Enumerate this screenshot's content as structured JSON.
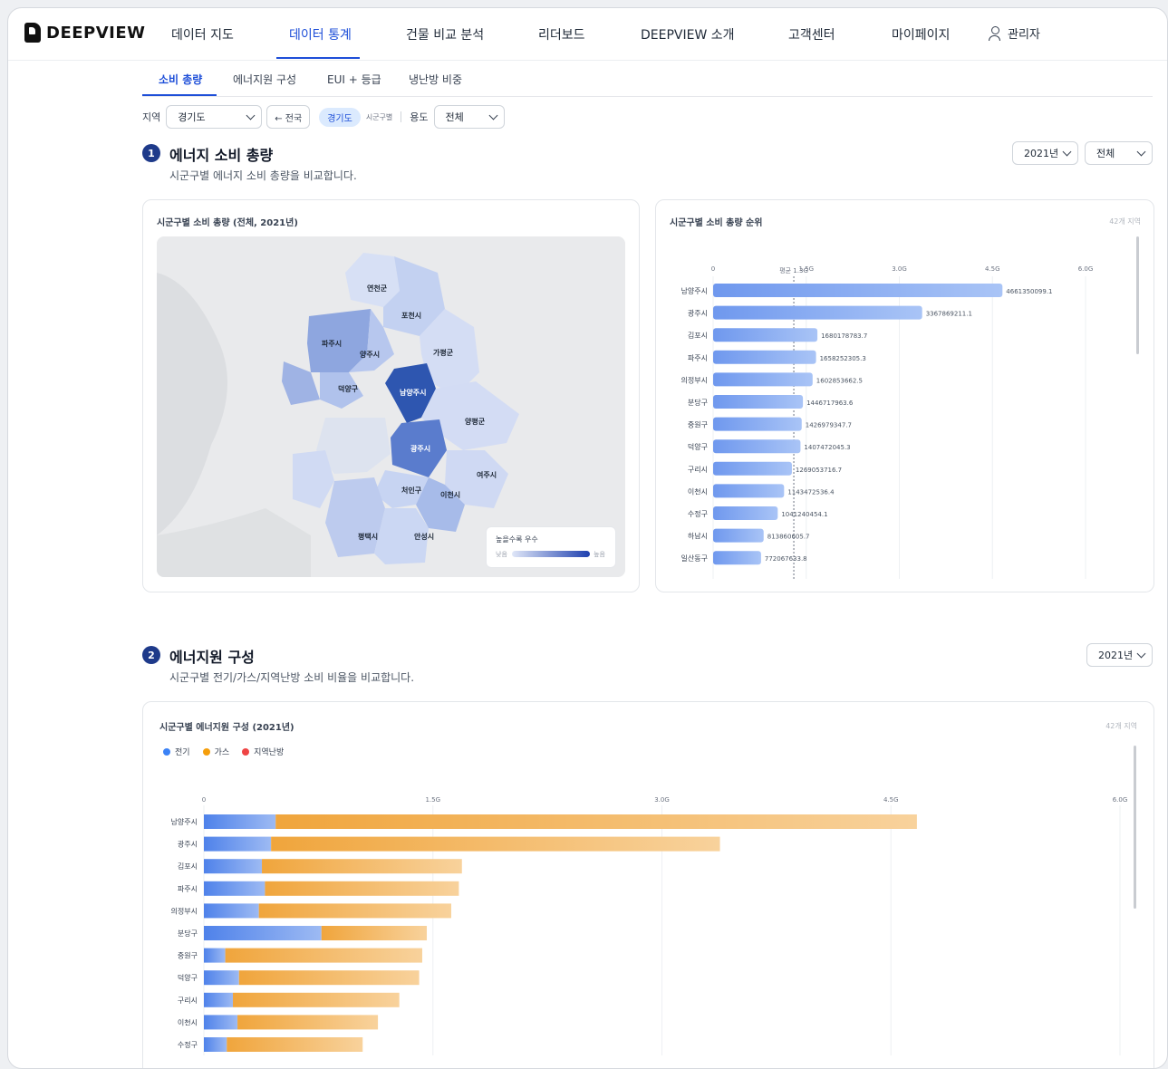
{
  "brand": {
    "name": "DEEPVIEW"
  },
  "nav": {
    "items": [
      {
        "label": "데이터 지도",
        "x": 180
      },
      {
        "label": "데이터 통계",
        "x": 310
      },
      {
        "label": "건물 비교 분석",
        "x": 439
      },
      {
        "label": "리더보드",
        "x": 585
      },
      {
        "label": "DEEPVIEW 소개",
        "x": 698
      },
      {
        "label": "고객센터",
        "x": 861
      },
      {
        "label": "마이페이지",
        "x": 975
      }
    ],
    "user_label": "관리자"
  },
  "subtabs": {
    "items": [
      "소비 총량",
      "에너지원 구성",
      "EUI + 등급",
      "냉난방 비중"
    ]
  },
  "filters": {
    "region_label": "지역",
    "region_value": "경기도",
    "back_label": "← 전국",
    "breadcrumb_chip": "경기도",
    "breadcrumb_sub": "시군구별",
    "use_label": "용도",
    "use_value": "전체"
  },
  "section1": {
    "num": "1",
    "title": "에너지 소비 총량",
    "desc": "시군구별 에너지 소비 총량을 비교합니다.",
    "year": "2021년",
    "scope": "전체",
    "map_card_title": "시군구별 소비 총량 (전체, 2021년)",
    "rank_card_title": "시군구별 소비 총량 순위",
    "rank_count": "42개 지역",
    "legend_title": "높을수록 우수",
    "legend_low": "낮음",
    "legend_high": "높음",
    "avg_label": "평균 1.3G"
  },
  "map_labels": [
    "연천군",
    "포천시",
    "파주시",
    "양주시",
    "가평군",
    "덕양구",
    "남양주시",
    "양평군",
    "광주시",
    "여주시",
    "처인구",
    "이천시",
    "평택시",
    "안성시"
  ],
  "section2": {
    "num": "2",
    "title": "에너지원 구성",
    "desc": "시군구별 전기/가스/지역난방 소비 비율을 비교합니다.",
    "year": "2021년",
    "card_title": "시군구별 에너지원 구성 (2021년)",
    "count": "42개 지역",
    "legend": [
      {
        "label": "전기",
        "color": "#3b82f6"
      },
      {
        "label": "가스",
        "color": "#f59e0b"
      },
      {
        "label": "지역난방",
        "color": "#ef4444"
      }
    ]
  },
  "chart_data": [
    {
      "type": "bar",
      "orientation": "horizontal",
      "title": "시군구별 소비 총량 순위",
      "categories": [
        "남양주시",
        "광주시",
        "김포시",
        "파주시",
        "의정부시",
        "분당구",
        "중원구",
        "덕양구",
        "구리시",
        "이천시",
        "수정구",
        "하남시",
        "일산동구"
      ],
      "values": [
        4661350099.1,
        3367869211.1,
        1680178783.7,
        1658252305.3,
        1602853662.5,
        1446717963.6,
        1426979347.7,
        1407472045.3,
        1269053716.7,
        1143472536.4,
        1041240454.1,
        813860605.7,
        772067633.8
      ],
      "value_labels": [
        "4661350099.1",
        "3367869211.1",
        "1680178783.7",
        "1658252305.3",
        "1602853662.5",
        "1446717963.6",
        "1426979347.7",
        "1407472045.3",
        "1269053716.7",
        "1143472536.4",
        "1041240454.1",
        "813860605.7",
        "772067633.8"
      ],
      "xticks": [
        "0",
        "1.5G",
        "3.0G",
        "4.5G",
        "6.0G"
      ],
      "xlim": [
        0,
        6000000000
      ],
      "average": 1300000000
    },
    {
      "type": "bar",
      "orientation": "horizontal",
      "stacked": true,
      "title": "시군구별 에너지원 구성 (2021년)",
      "categories": [
        "남양주시",
        "광주시",
        "김포시",
        "파주시",
        "의정부시",
        "분당구",
        "중원구",
        "덕양구",
        "구리시",
        "이천시",
        "수정구"
      ],
      "series": [
        {
          "name": "전기",
          "values": [
            0.47,
            0.44,
            0.38,
            0.4,
            0.36,
            0.77,
            0.14,
            0.23,
            0.19,
            0.22,
            0.15
          ]
        },
        {
          "name": "가스",
          "values": [
            4.2,
            2.94,
            1.31,
            1.27,
            1.26,
            0.69,
            1.29,
            1.18,
            1.09,
            0.92,
            0.89
          ]
        },
        {
          "name": "지역난방",
          "values": [
            0,
            0,
            0,
            0,
            0,
            0,
            0,
            0,
            0,
            0,
            0
          ]
        }
      ],
      "unit": "G",
      "xticks": [
        "0",
        "1.5G",
        "3.0G",
        "4.5G",
        "6.0G"
      ],
      "xlim": [
        0,
        6.0
      ]
    }
  ]
}
